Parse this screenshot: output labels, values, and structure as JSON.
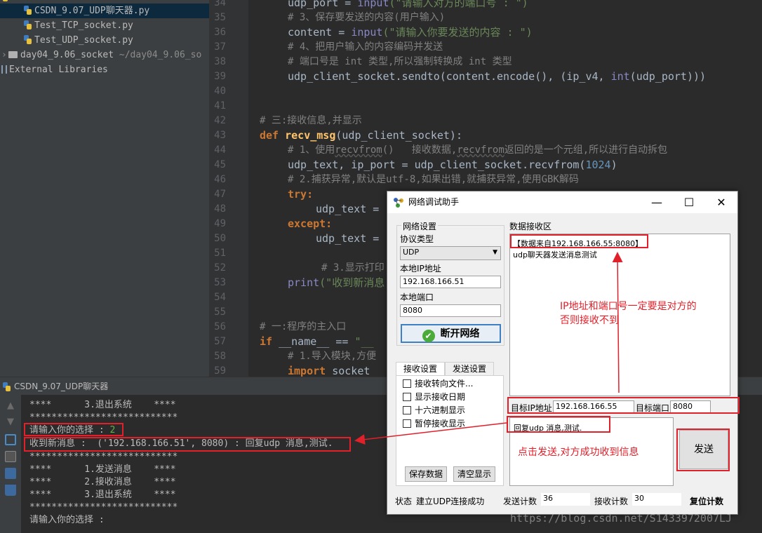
{
  "project_tree": {
    "items": [
      {
        "label": "CSDN_9.07_UDP聊天器.py",
        "type": "py",
        "selected": true
      },
      {
        "label": "Test_TCP_socket.py",
        "type": "py"
      },
      {
        "label": "Test_UDP_socket.py",
        "type": "py"
      },
      {
        "label": "day04_9.06_socket",
        "type": "folder",
        "path": "~/day04_9.06_so"
      },
      {
        "label": "External Libraries",
        "type": "lib"
      }
    ]
  },
  "editor": {
    "line_numbers": [
      "34",
      "35",
      "36",
      "37",
      "38",
      "39",
      "40",
      "41",
      "42",
      "43",
      "44",
      "45",
      "46",
      "47",
      "48",
      "49",
      "50",
      "51",
      "52",
      "53",
      "54",
      "55",
      "56",
      "57",
      "58",
      "59"
    ],
    "lines": {
      "l34a": "udp_port = ",
      "l34b": "input",
      "l34c": "(\"请输入对方的端口号 : \")",
      "l35": "# 3、保存要发送的内容(用户输入)",
      "l36a": "content = ",
      "l36b": "input",
      "l36c": "(\"请输入你要发送的内容 : \")",
      "l37": "# 4、把用户输入的内容编码并发送",
      "l38": "# 端口号是 int 类型,所以强制转换成 int 类型",
      "l39a": "udp_client_socket.sendto(content.encode(), (ip_v4, ",
      "l39b": "int",
      "l39c": "(udp_port)))",
      "l42": "# 三:接收信息,并显示",
      "l43a": "def ",
      "l43b": "recv_msg",
      "l43c": "(udp_client_socket):",
      "l44a": "# 1、使用",
      "l44b": "recvfrom",
      "l44c": "()   接收数据,",
      "l44d": "recvfrom",
      "l44e": "返回的是一个元组,所以进行自动拆包",
      "l45a": "udp_text, ip_port = udp_client_socket.recvfrom(",
      "l45b": "1024",
      "l45c": ")",
      "l46": "# 2.捕获异常,默认是utf-8,如果出错,就捕获异常,使用GBK解码",
      "l47": "try:",
      "l48": "udp_text =",
      "l49": "except:",
      "l50": "udp_text =",
      "l52": "# 3.显示打印",
      "l53a": "print",
      "l53b": "(\"收到新消息",
      "l56": "# 一:程序的主入口",
      "l57a": "if ",
      "l57b": "__name__ == ",
      "l57c": "\"__",
      "l58": "# 1.导入模块,方便",
      "l59a": "import ",
      "l59b": "socket"
    }
  },
  "run_panel": {
    "title": "CSDN_9.07_UDP聊天器",
    "console": {
      "c0": "****      3.退出系统    ****",
      "c1": "***************************",
      "c2a": "请输入你的选择 : ",
      "c2b": "2",
      "c3": "收到新消息 :  ('192.168.166.51', 8080) : 回复udp 消息,测试.",
      "c4": "***************************",
      "c5": "****      1.发送消息    ****",
      "c6": "****      2.接收消息    ****",
      "c7": "****      3.退出系统    ****",
      "c8": "***************************",
      "c9": "请输入你的选择 :"
    }
  },
  "dialog": {
    "title": "网络调试助手",
    "network_settings": "网络设置",
    "protocol_label": "协议类型",
    "protocol_value": "UDP",
    "local_ip_label": "本地IP地址",
    "local_ip": "192.168.166.51",
    "local_port_label": "本地端口",
    "local_port": "8080",
    "disconnect_label": "断开网络",
    "tab_recv": "接收设置",
    "tab_send": "发送设置",
    "opt_redirect": "接收转向文件...",
    "opt_date": "显示接收日期",
    "opt_hex": "十六进制显示",
    "opt_pause": "暂停接收显示",
    "save_data": "保存数据",
    "clear_display": "清空显示",
    "recv_area_label": "数据接收区",
    "recv_header": "【数据来自192.168.166.55:8080】",
    "recv_body": "udp聊天器发送消息测试",
    "target_ip_label": "目标IP地址",
    "target_ip": "192.168.166.55",
    "target_port_label": "目标端口",
    "target_port": "8080",
    "send_text": "回复udp 消息,测试.",
    "send_button": "发送",
    "status_label": "状态",
    "status_value": "建立UDP连接成功",
    "send_count_label": "发送计数",
    "send_count": "36",
    "recv_count_label": "接收计数",
    "recv_count": "30",
    "reset_count": "复位计数"
  },
  "annotations": {
    "note1_line1": "IP地址和端口号一定要是对方的",
    "note1_line2": "否则接收不到",
    "note2": "点击发送,对方成功收到信息"
  },
  "watermark": "https://blog.csdn.net/S1433972007LJ"
}
